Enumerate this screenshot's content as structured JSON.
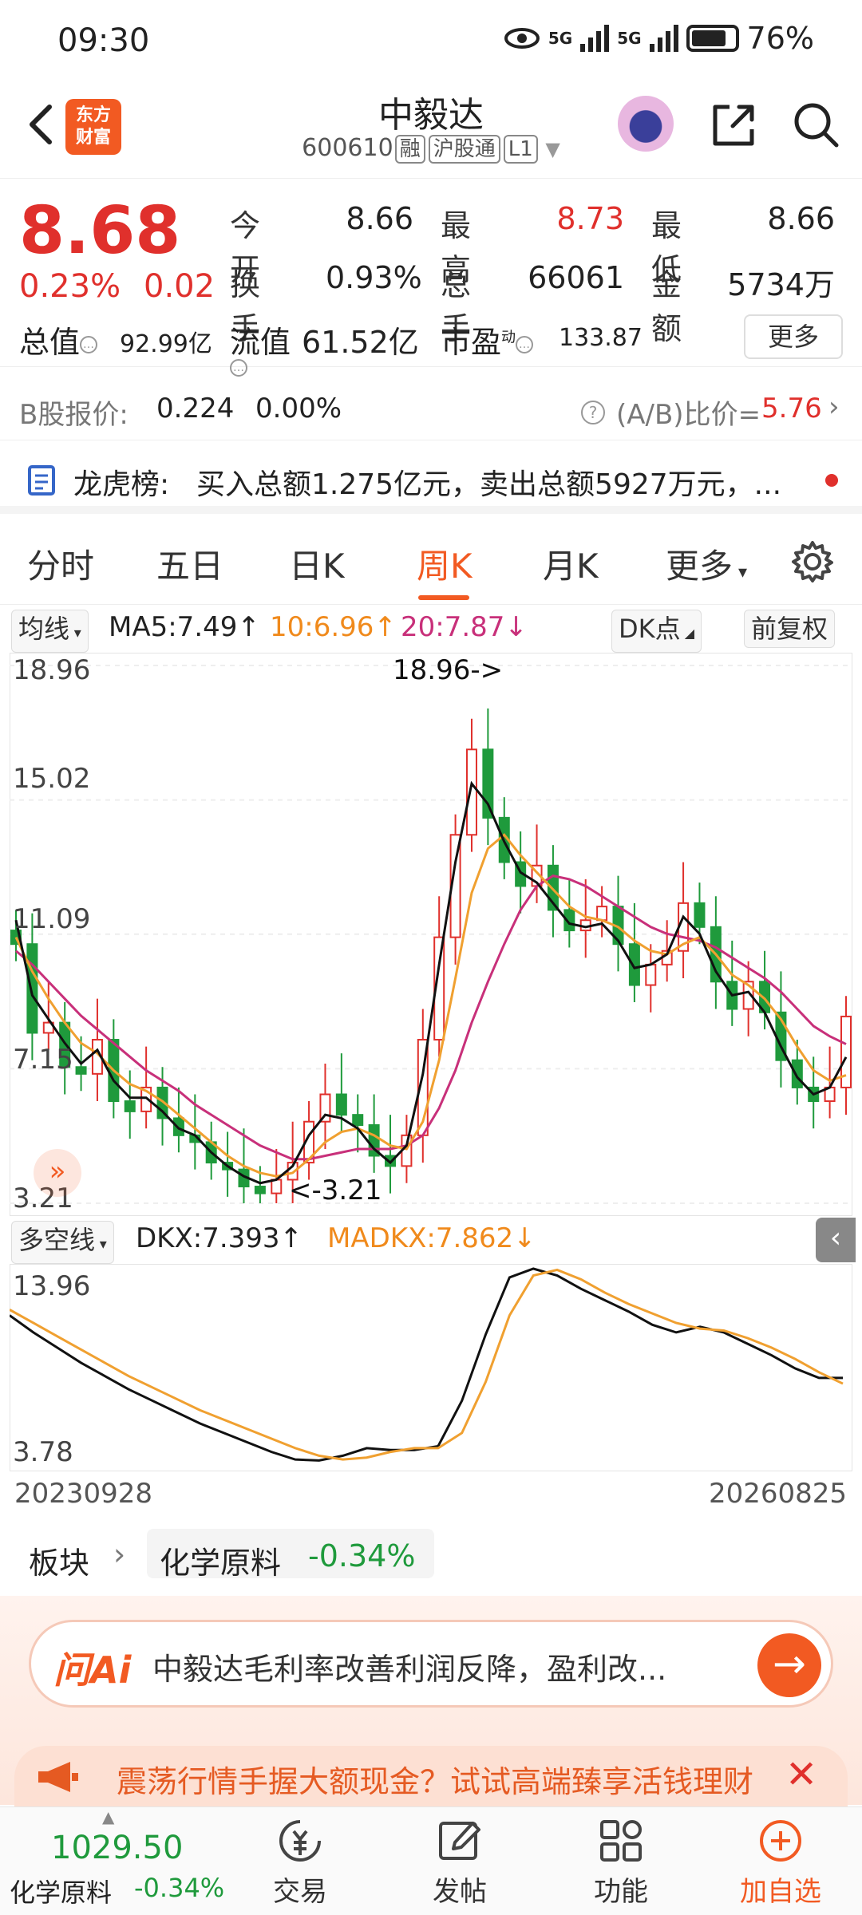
{
  "status_bar": {
    "time": "09:30",
    "net1": "5G",
    "net2": "5G",
    "battery": "76%"
  },
  "header": {
    "logo_line1": "东方",
    "logo_line2": "财富",
    "title": "中毅达",
    "code": "600610",
    "tag1": "融",
    "tag2": "沪股通",
    "tag3": "L1"
  },
  "quote": {
    "price": "8.68",
    "change_pct": "0.23%",
    "change_abs": "0.02",
    "open_label": "今开",
    "open": "8.66",
    "high_label": "最高",
    "high": "8.73",
    "low_label": "最低",
    "low": "8.66",
    "turnover_label": "换手",
    "turnover": "0.93%",
    "volume_label": "总手",
    "volume": "66061",
    "amount_label": "金额",
    "amount": "5734万",
    "mktcap_label": "总值",
    "mktcap": "92.99亿",
    "float_label": "流值",
    "float": "61.52亿",
    "pe_label": "市盈",
    "pe_sup": "动",
    "pe": "133.87",
    "more": "更多"
  },
  "bshare": {
    "label": "B股报价:",
    "price": "0.224",
    "pct": "0.00%",
    "ratio_label": "(A/B)比价=",
    "ratio": "5.76"
  },
  "dragon": {
    "label": "龙虎榜:",
    "text": "买入总额1.275亿元，卖出总额5927万元，..."
  },
  "tabs": [
    {
      "label": "分时"
    },
    {
      "label": "五日"
    },
    {
      "label": "日K"
    },
    {
      "label": "周K"
    },
    {
      "label": "月K"
    },
    {
      "label": "更多"
    }
  ],
  "ma_bar": {
    "type": "均线",
    "ma5": "MA5:7.49↑",
    "ma10": "10:6.96↑",
    "ma20": "20:7.87↓",
    "dk": "DK点",
    "adj": "前复权"
  },
  "colors": {
    "up": "#e0302c",
    "down": "#1f9a3c",
    "ma5": "#111111",
    "ma10": "#f0a030",
    "ma20": "#c8307a",
    "accent": "#f25a22"
  },
  "dkx_bar": {
    "type": "多空线",
    "dkx": "DKX:7.393↑",
    "madkx": "MADKX:7.862↓"
  },
  "chart_data": [
    {
      "type": "candlestick",
      "title": "周K",
      "y_labels": [
        "18.96",
        "15.02",
        "11.09",
        "7.15",
        "3.21"
      ],
      "ylim": [
        3.21,
        18.96
      ],
      "annotations": [
        "18.96->",
        "<-3.21"
      ],
      "close_series_approx": [
        10.8,
        8.2,
        8.5,
        7.2,
        7.0,
        8.0,
        6.2,
        5.9,
        6.6,
        5.7,
        5.2,
        5.0,
        4.4,
        4.2,
        3.7,
        3.5,
        3.9,
        4.4,
        5.6,
        6.4,
        5.8,
        5.5,
        4.6,
        4.3,
        5.2,
        8.0,
        11.0,
        14.0,
        16.5,
        14.5,
        13.2,
        12.5,
        13.1,
        11.8,
        11.2,
        11.5,
        11.9,
        10.8,
        9.6,
        10.2,
        10.6,
        12.0,
        11.3,
        9.7,
        8.9,
        9.7,
        8.8,
        7.4,
        6.6,
        6.2,
        6.6,
        8.68
      ],
      "ma5_approx": [
        11.5,
        9.3,
        8.6,
        7.9,
        7.3,
        7.7,
        6.8,
        6.3,
        6.3,
        5.9,
        5.4,
        5.2,
        4.7,
        4.3,
        4.0,
        3.8,
        3.9,
        4.3,
        5.2,
        5.8,
        5.7,
        5.4,
        4.8,
        4.4,
        4.9,
        7.0,
        10.2,
        13.2,
        15.5,
        14.9,
        13.8,
        12.9,
        12.6,
        12.0,
        11.4,
        11.3,
        11.4,
        10.9,
        10.1,
        10.2,
        10.5,
        11.6,
        11.1,
        10.0,
        9.3,
        9.4,
        8.8,
        7.8,
        6.9,
        6.4,
        6.6,
        7.49
      ],
      "ma10_approx": [
        11.0,
        10.0,
        9.2,
        8.5,
        7.9,
        7.6,
        7.1,
        6.7,
        6.5,
        6.2,
        5.8,
        5.4,
        5.0,
        4.6,
        4.3,
        4.1,
        4.0,
        4.1,
        4.5,
        5.0,
        5.3,
        5.4,
        5.2,
        4.9,
        4.8,
        5.6,
        7.4,
        9.8,
        12.3,
        13.6,
        14.0,
        13.4,
        12.9,
        12.4,
        11.9,
        11.6,
        11.5,
        11.3,
        10.9,
        10.6,
        10.5,
        10.8,
        11.0,
        10.5,
        9.9,
        9.6,
        9.2,
        8.6,
        7.8,
        7.1,
        6.8,
        6.96
      ],
      "ma20_approx": [
        10.6,
        10.2,
        9.7,
        9.2,
        8.7,
        8.3,
        7.9,
        7.5,
        7.1,
        6.8,
        6.5,
        6.1,
        5.8,
        5.5,
        5.2,
        4.9,
        4.7,
        4.5,
        4.5,
        4.6,
        4.7,
        4.8,
        4.8,
        4.8,
        4.9,
        5.2,
        6.0,
        7.1,
        8.5,
        9.7,
        10.8,
        11.8,
        12.5,
        12.8,
        12.7,
        12.5,
        12.2,
        11.9,
        11.6,
        11.3,
        11.1,
        11.0,
        10.9,
        10.7,
        10.4,
        10.1,
        9.8,
        9.4,
        8.9,
        8.4,
        8.1,
        7.87
      ]
    },
    {
      "type": "line",
      "title": "多空线",
      "y_labels": [
        "13.96",
        "3.78"
      ],
      "ylim": [
        3.78,
        13.96
      ],
      "x_start": "20230928",
      "x_end": "20260825",
      "series": [
        {
          "name": "DKX",
          "values": [
            11.5,
            10.6,
            9.8,
            9.0,
            8.3,
            7.6,
            7.0,
            6.4,
            5.8,
            5.3,
            4.8,
            4.3,
            3.9,
            3.85,
            4.1,
            4.5,
            4.4,
            4.4,
            4.6,
            7.0,
            10.5,
            13.5,
            13.96,
            13.6,
            12.9,
            12.3,
            11.7,
            11.0,
            10.6,
            10.9,
            10.6,
            10.0,
            9.4,
            8.7,
            8.2,
            8.2
          ]
        },
        {
          "name": "MADKX",
          "values": [
            11.8,
            11.1,
            10.4,
            9.7,
            9.0,
            8.3,
            7.7,
            7.1,
            6.5,
            6.0,
            5.5,
            5.0,
            4.5,
            4.1,
            3.9,
            4.0,
            4.3,
            4.5,
            4.5,
            5.3,
            8.0,
            11.5,
            13.6,
            13.9,
            13.4,
            12.7,
            12.1,
            11.6,
            11.1,
            10.8,
            10.7,
            10.3,
            9.8,
            9.2,
            8.5,
            7.9
          ]
        }
      ]
    }
  ],
  "sector": {
    "label": "板块",
    "name": "化学原料",
    "pct": "-0.34%"
  },
  "ai": {
    "logo": "问Ai",
    "text": "中毅达毛利率改善利润反降，盈利改..."
  },
  "ad": {
    "text": "震荡行情手握大额现金？试试高端臻享活钱理财"
  },
  "bottom_nav": {
    "index_value": "1029.50",
    "index_name": "化学原料",
    "index_pct": "-0.34%",
    "items": [
      {
        "label": "交易"
      },
      {
        "label": "发帖"
      },
      {
        "label": "功能"
      },
      {
        "label": "加自选"
      }
    ]
  }
}
